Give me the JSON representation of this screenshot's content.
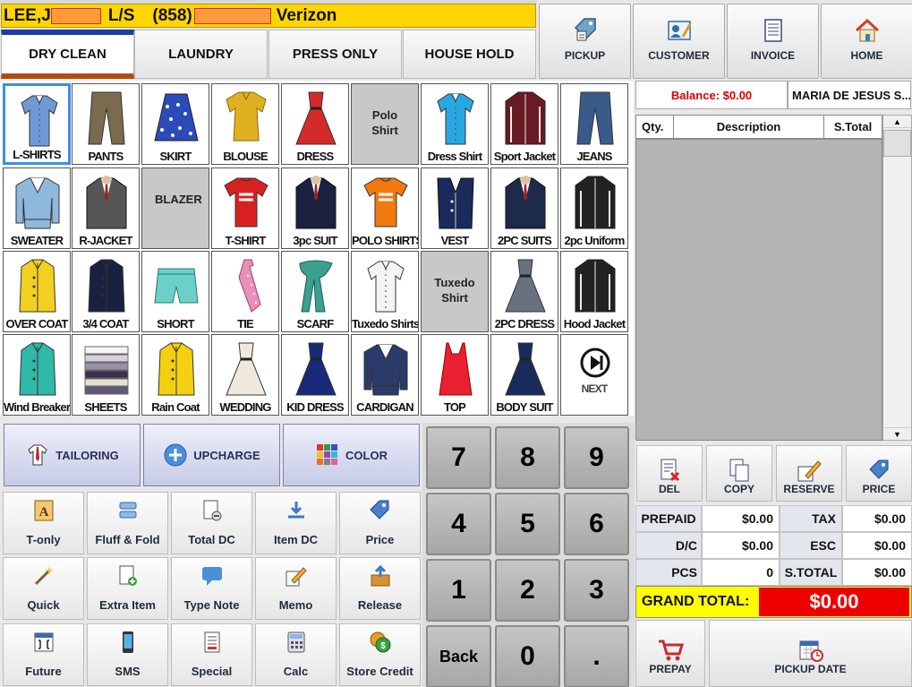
{
  "customer": {
    "last_first": "LEE,J",
    "tag": "L/S",
    "area_code": "(858)",
    "carrier": "Verizon"
  },
  "tabs": [
    {
      "label": "DRY CLEAN",
      "active": true
    },
    {
      "label": "LAUNDRY"
    },
    {
      "label": "PRESS ONLY"
    },
    {
      "label": "HOUSE HOLD"
    }
  ],
  "top_buttons": {
    "pickup": "PICKUP",
    "customer": "CUSTOMER",
    "invoice": "INVOICE",
    "home": "HOME"
  },
  "items": [
    {
      "label": "L-SHIRTS",
      "icon": "shirt-icon",
      "color": "#6f9ad6"
    },
    {
      "label": "PANTS",
      "icon": "pants-icon",
      "color": "#7a6a4e"
    },
    {
      "label": "SKIRT",
      "icon": "skirt-icon",
      "color": "#2a4bb8"
    },
    {
      "label": "BLOUSE",
      "icon": "blouse-icon",
      "color": "#e0b020"
    },
    {
      "label": "DRESS",
      "icon": "dress-icon",
      "color": "#d42a2a"
    },
    {
      "label": "Polo Shirt",
      "icon": "",
      "gray": true
    },
    {
      "label": "Dress Shirt",
      "icon": "shirt-icon",
      "color": "#28a8e0"
    },
    {
      "label": "Sport Jacket",
      "icon": "jacket-icon",
      "color": "#6a1a22"
    },
    {
      "label": "JEANS",
      "icon": "pants-icon",
      "color": "#3a5a8a"
    },
    {
      "label": "SWEATER",
      "icon": "sweater-icon",
      "color": "#8eb8dc"
    },
    {
      "label": "R-JACKET",
      "icon": "suit-icon",
      "color": "#555"
    },
    {
      "label": "BLAZER",
      "icon": "",
      "gray": true
    },
    {
      "label": "T-SHIRT",
      "icon": "tshirt-icon",
      "color": "#d82020"
    },
    {
      "label": "3pc SUIT",
      "icon": "suit-icon",
      "color": "#1a2240"
    },
    {
      "label": "POLO SHIRTS",
      "icon": "tshirt-icon",
      "color": "#f07a10"
    },
    {
      "label": "VEST",
      "icon": "vest-icon",
      "color": "#1a2a5a"
    },
    {
      "label": "2PC SUITS",
      "icon": "suit-icon",
      "color": "#1e2a4a"
    },
    {
      "label": "2pc Uniform",
      "icon": "jacket-icon",
      "color": "#222"
    },
    {
      "label": "OVER COAT",
      "icon": "coat-icon",
      "color": "#f2d020"
    },
    {
      "label": "3/4 COAT",
      "icon": "coat-icon",
      "color": "#1a2040"
    },
    {
      "label": "SHORT",
      "icon": "short-icon",
      "color": "#6ad0c8"
    },
    {
      "label": "TIE",
      "icon": "tie-icon",
      "color": "#e890b8"
    },
    {
      "label": "SCARF",
      "icon": "scarf-icon",
      "color": "#3aa090"
    },
    {
      "label": "Tuxedo Shirts",
      "icon": "shirt-icon",
      "color": "#f4f4f4"
    },
    {
      "label": "Tuxedo Shirt",
      "icon": "",
      "gray": true
    },
    {
      "label": "2PC DRESS",
      "icon": "dress-icon",
      "color": "#6a7080"
    },
    {
      "label": "Hood Jacket",
      "icon": "jacket-icon",
      "color": "#222"
    },
    {
      "label": "Wind Breaker",
      "icon": "coat-icon",
      "color": "#30b8a8"
    },
    {
      "label": "SHEETS",
      "icon": "sheets-icon",
      "color": "#9a90a8"
    },
    {
      "label": "Rain Coat",
      "icon": "coat-icon",
      "color": "#f4d010"
    },
    {
      "label": "WEDDING",
      "icon": "dress-icon",
      "color": "#efe8dc"
    },
    {
      "label": "KID DRESS",
      "icon": "dress-icon",
      "color": "#1a2a7a"
    },
    {
      "label": "CARDIGAN",
      "icon": "sweater-icon",
      "color": "#2a3a6a"
    },
    {
      "label": "TOP",
      "icon": "top-icon",
      "color": "#e82030"
    },
    {
      "label": "BODY SUIT",
      "icon": "dress-icon",
      "color": "#1a2a5a"
    },
    {
      "label": "NEXT",
      "icon": "next-icon",
      "next": true
    }
  ],
  "service_buttons": {
    "tailoring": "TAILORING",
    "upcharge": "UPCHARGE",
    "color": "COLOR"
  },
  "func_buttons": [
    {
      "label": "T-only",
      "icon": "letter-a-icon"
    },
    {
      "label": "Fluff & Fold",
      "icon": "fold-icon"
    },
    {
      "label": "Total DC",
      "icon": "doc-minus-icon"
    },
    {
      "label": "Item DC",
      "icon": "download-icon"
    },
    {
      "label": "Price",
      "icon": "price-tag-icon"
    },
    {
      "label": "Quick",
      "icon": "wand-icon"
    },
    {
      "label": "Extra Item",
      "icon": "doc-plus-icon"
    },
    {
      "label": "Type Note",
      "icon": "speech-icon"
    },
    {
      "label": "Memo",
      "icon": "pencil-icon"
    },
    {
      "label": "Release",
      "icon": "upload-box-icon"
    },
    {
      "label": "Future",
      "icon": "calendar-grid-icon"
    },
    {
      "label": "SMS",
      "icon": "phone-icon"
    },
    {
      "label": "Special",
      "icon": "doc-icon"
    },
    {
      "label": "Calc",
      "icon": "calculator-icon"
    },
    {
      "label": "Store Credit",
      "icon": "coins-icon"
    }
  ],
  "numpad": [
    "7",
    "8",
    "9",
    "4",
    "5",
    "6",
    "1",
    "2",
    "3",
    "Back",
    "0",
    "."
  ],
  "balance": "Balance: $0.00",
  "customer_name": "MARIA DE JESUS S...",
  "list_columns": {
    "qty": "Qty.",
    "desc": "Description",
    "stotal": "S.Total"
  },
  "actions": {
    "del": "DEL",
    "copy": "COPY",
    "reserve": "RESERVE",
    "price": "PRICE"
  },
  "totals": {
    "prepaid_label": "PREPAID",
    "prepaid": "$0.00",
    "tax_label": "TAX",
    "tax": "$0.00",
    "dc_label": "D/C",
    "dc": "$0.00",
    "esc_label": "ESC",
    "esc": "$0.00",
    "pcs_label": "PCS",
    "pcs": "0",
    "stotal_label": "S.TOTAL",
    "stotal": "$0.00"
  },
  "grand_total_label": "GRAND TOTAL:",
  "grand_total": "$0.00",
  "bottom_buttons": {
    "prepay": "PREPAY",
    "pickup_date": "PICKUP DATE"
  }
}
